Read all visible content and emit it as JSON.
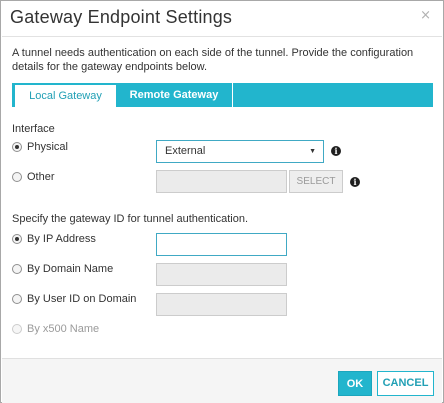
{
  "dialog": {
    "title": "Gateway Endpoint Settings",
    "close_glyph": "×",
    "intro": "A tunnel needs authentication on each side of the tunnel. Provide the configuration details for the gateway endpoints below."
  },
  "tabs": [
    {
      "label": "Local Gateway",
      "active": true
    },
    {
      "label": "Remote Gateway",
      "active": false
    }
  ],
  "interface": {
    "heading": "Interface",
    "physical_label": "Physical",
    "physical_selected": true,
    "physical_value": "External",
    "other_label": "Other",
    "other_value": "",
    "select_button": "SELECT",
    "info_icon": "i"
  },
  "gateway_id": {
    "heading": "Specify the gateway ID for tunnel authentication.",
    "options": [
      {
        "label": "By IP Address",
        "selected": true,
        "value": ""
      },
      {
        "label": "By Domain Name",
        "selected": false,
        "value": ""
      },
      {
        "label": "By User ID on Domain",
        "selected": false,
        "value": ""
      },
      {
        "label": "By x500 Name",
        "selected": false,
        "disabled": true
      }
    ]
  },
  "footer": {
    "ok_label": "OK",
    "cancel_label": "CANCEL"
  },
  "colors": {
    "accent": "#22b5cd",
    "focus_border": "#40a9c4"
  },
  "icons": {
    "close": "close-icon",
    "info": "info-icon",
    "dropdown": "chevron-down-icon"
  }
}
